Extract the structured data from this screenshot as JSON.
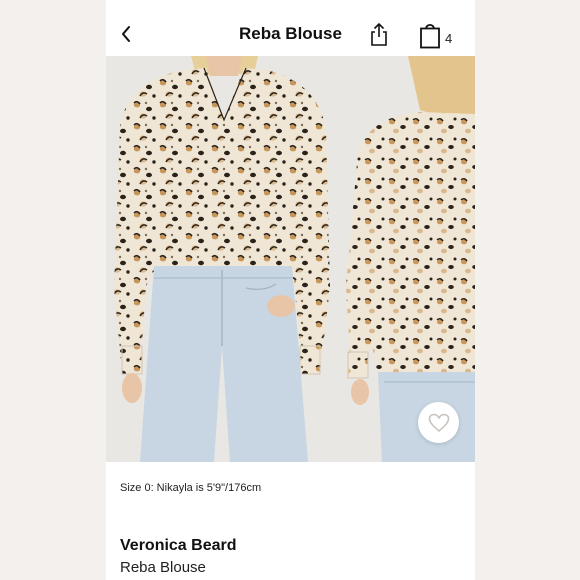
{
  "header": {
    "title": "Reba Blouse",
    "back_icon": "chevron-left-icon",
    "share_icon": "share-icon",
    "bag_icon": "shopping-bag-icon",
    "bag_count": "4"
  },
  "gallery": {
    "images": [
      {
        "name": "model-front-photo"
      },
      {
        "name": "model-back-photo"
      }
    ],
    "favorite_icon": "heart-icon"
  },
  "product": {
    "size_caption": "Size 0: Nikayla is 5'9\"/176cm",
    "brand": "Veronica Beard",
    "name": "Reba Blouse"
  },
  "colors": {
    "background": "#f4f0ee",
    "panel": "#ffffff",
    "text": "#111111",
    "denim": "#c7d6e2",
    "print_base": "#efe6d6",
    "print_spot": "#2b2219",
    "print_tan": "#c9965a"
  }
}
